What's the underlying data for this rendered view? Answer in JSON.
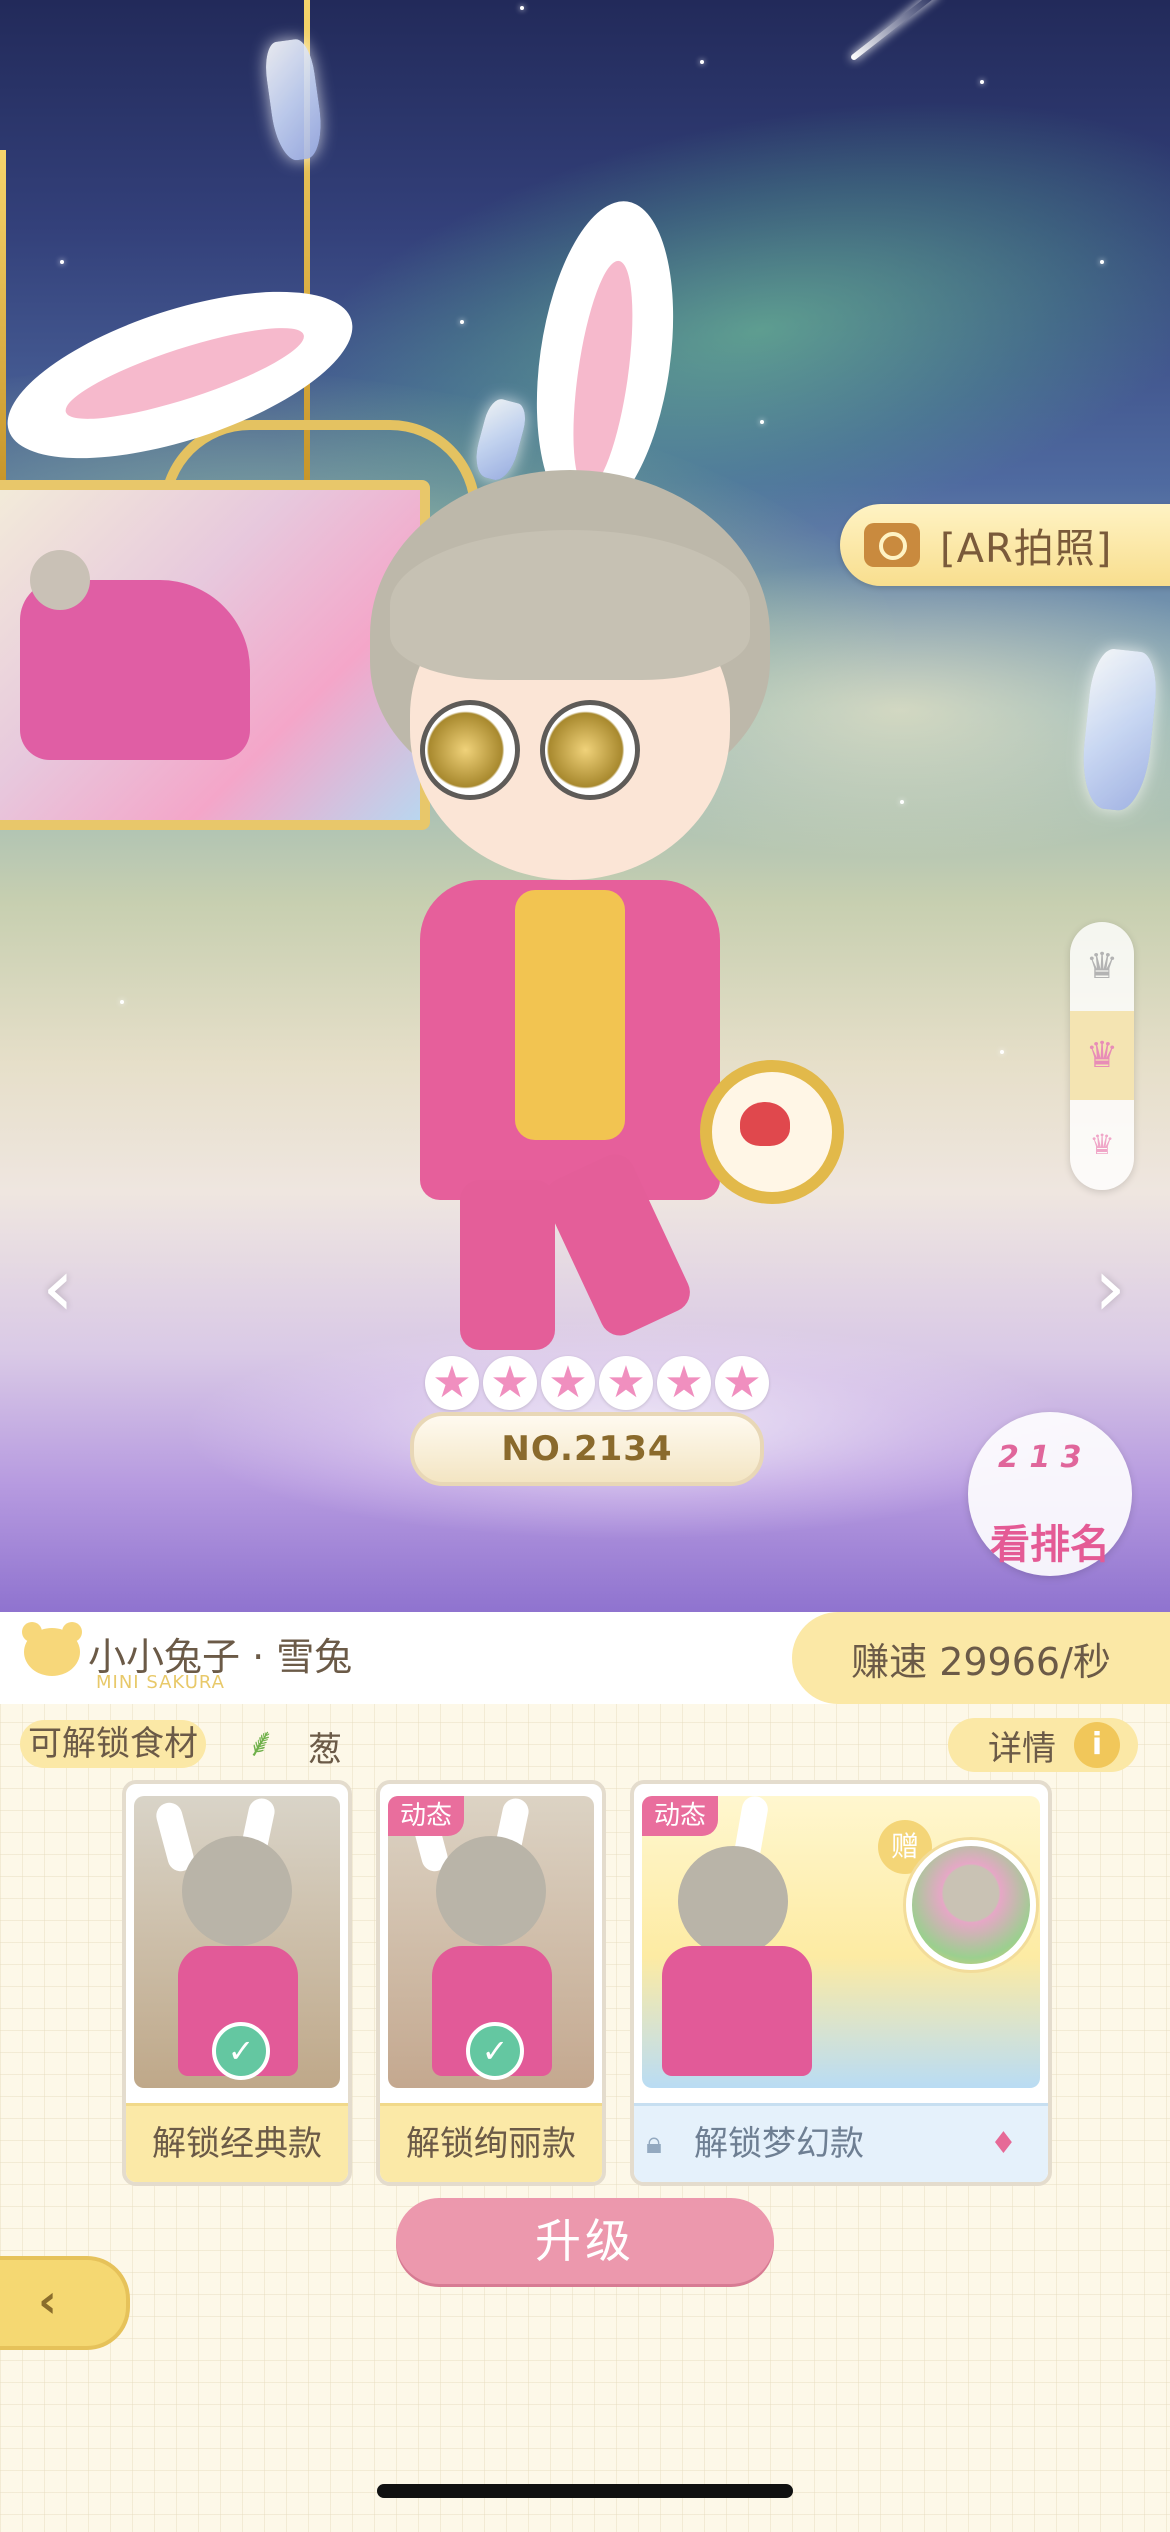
{
  "scene": {
    "ar_button": {
      "label": "[AR拍照]",
      "icon": "camera-icon"
    },
    "crown_selector": {
      "icons": [
        "crown-gray-icon",
        "crown-pink-icon",
        "crown-small-icon"
      ],
      "selected_index": 1
    },
    "nav": {
      "prev_icon": "chevron-left-icon",
      "next_icon": "chevron-right-icon",
      "prev_glyph": "‹",
      "next_glyph": "›"
    },
    "stars": {
      "count": 6,
      "max": 6,
      "glyph": "★"
    },
    "number_badge": "NO.2134",
    "rank_button": {
      "podium": "2 1 3",
      "label": "看排名"
    }
  },
  "character": {
    "name": "小小兔子 · 雪兔",
    "subtitle": "MINI SAKURA",
    "speed": "赚速 29966/秒"
  },
  "ingredients": {
    "label": "可解锁食材",
    "item": "葱",
    "item_icon": "leek-icon",
    "detail_label": "详情",
    "detail_icon": "info-icon",
    "detail_glyph": "i"
  },
  "cards": [
    {
      "label": "解锁经典款",
      "unlocked": true,
      "tag": ""
    },
    {
      "label": "解锁绚丽款",
      "unlocked": true,
      "tag": "动态"
    },
    {
      "label": "解锁梦幻款",
      "unlocked": false,
      "tag": "动态",
      "gift": "赠"
    }
  ],
  "upgrade_label": "升级",
  "colors": {
    "accent_pink": "#ec98ad",
    "panel_yellow": "#fbe8a6",
    "check_green": "#64c7a1"
  }
}
